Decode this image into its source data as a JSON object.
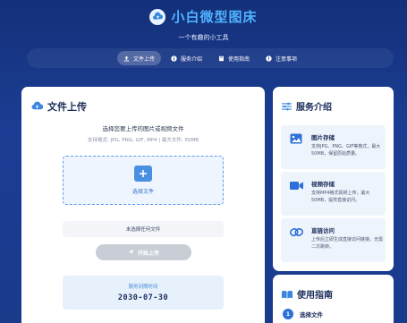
{
  "header": {
    "title": "小白微型图床",
    "subtitle": "一个有趣的小工具",
    "logo_icon": "cloud-upload-icon"
  },
  "nav": {
    "tabs": [
      {
        "label": "文件上传",
        "icon": "upload-icon",
        "active": true
      },
      {
        "label": "服务介绍",
        "icon": "info-icon",
        "active": false
      },
      {
        "label": "使用指南",
        "icon": "book-icon",
        "active": false
      },
      {
        "label": "注意事项",
        "icon": "warning-icon",
        "active": false
      }
    ]
  },
  "upload": {
    "title": "文件上传",
    "prompt": "选择您要上传的图片或视频文件",
    "formats": "支持格式: JPG, PNG, GIF, MP4 | 最大文件: 50MB",
    "dropzone_label": "选择文件",
    "file_status": "未选择任何文件",
    "upload_button": "开始上传",
    "expiry_label": "服务到期时间",
    "expiry_date": "2030-07-30"
  },
  "services": {
    "title": "服务介绍",
    "items": [
      {
        "name": "图片存储",
        "desc": "支持JPG、PNG、GIF等格式，最大50MB，保留原始质量。",
        "icon": "image-icon"
      },
      {
        "name": "视频存储",
        "desc": "支持MP4格式视频上传，最大50MB，提供直接访问。",
        "icon": "video-icon"
      },
      {
        "name": "直链访问",
        "desc": "上传后立即生成直接访问链接，无需二次跳转。",
        "icon": "link-icon"
      }
    ]
  },
  "guide": {
    "title": "使用指南",
    "steps": [
      {
        "num": "1",
        "text": "选择文件"
      }
    ]
  },
  "colors": {
    "accent": "#2e6fd8",
    "title_blue": "#4fb3ff",
    "background": "#1b3d93"
  }
}
